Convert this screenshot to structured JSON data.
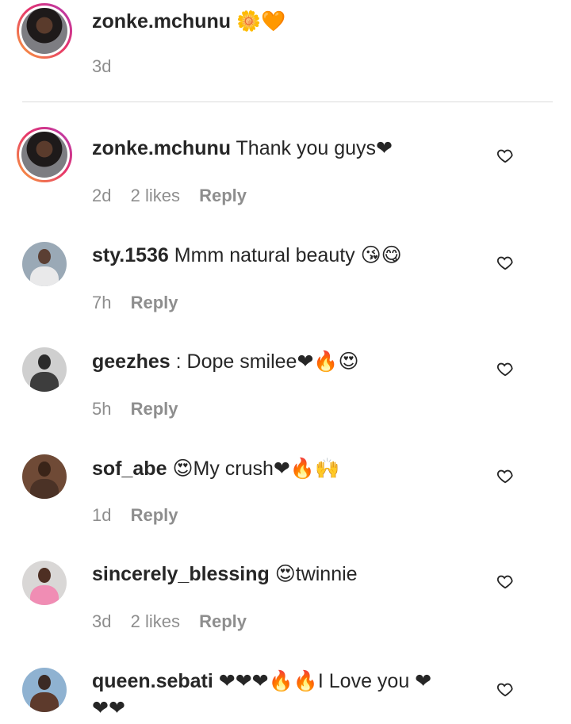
{
  "caption": {
    "username": "zonke.mchunu",
    "text": "🌼🧡",
    "time": "3d"
  },
  "comments": [
    {
      "username": "zonke.mchunu",
      "text": "Thank you guys❤",
      "time": "2d",
      "likes": "2 likes",
      "reply": "Reply"
    },
    {
      "username": "sty.1536",
      "text": "Mmm natural beauty 😘😋",
      "time": "7h",
      "reply": "Reply"
    },
    {
      "username": "geezhes",
      "text": " : Dope smilee❤🔥😍",
      "time": "5h",
      "reply": "Reply"
    },
    {
      "username": "sof_abe",
      "text": "😍My crush❤🔥🙌",
      "time": "1d",
      "reply": "Reply"
    },
    {
      "username": "sincerely_blessing",
      "text": "😍twinnie",
      "time": "3d",
      "likes": "2 likes",
      "reply": "Reply"
    },
    {
      "username": "queen.sebati",
      "text": "❤❤❤🔥🔥I Love you ❤",
      "text_line2": "❤❤"
    }
  ],
  "icons": {
    "like": "heart-outline-icon"
  },
  "colors": {
    "text": "#262626",
    "meta": "#8e8e8e",
    "divider": "#dbdbdb",
    "story_ring_start": "#f9a23a",
    "story_ring_end": "#b23ab5"
  }
}
